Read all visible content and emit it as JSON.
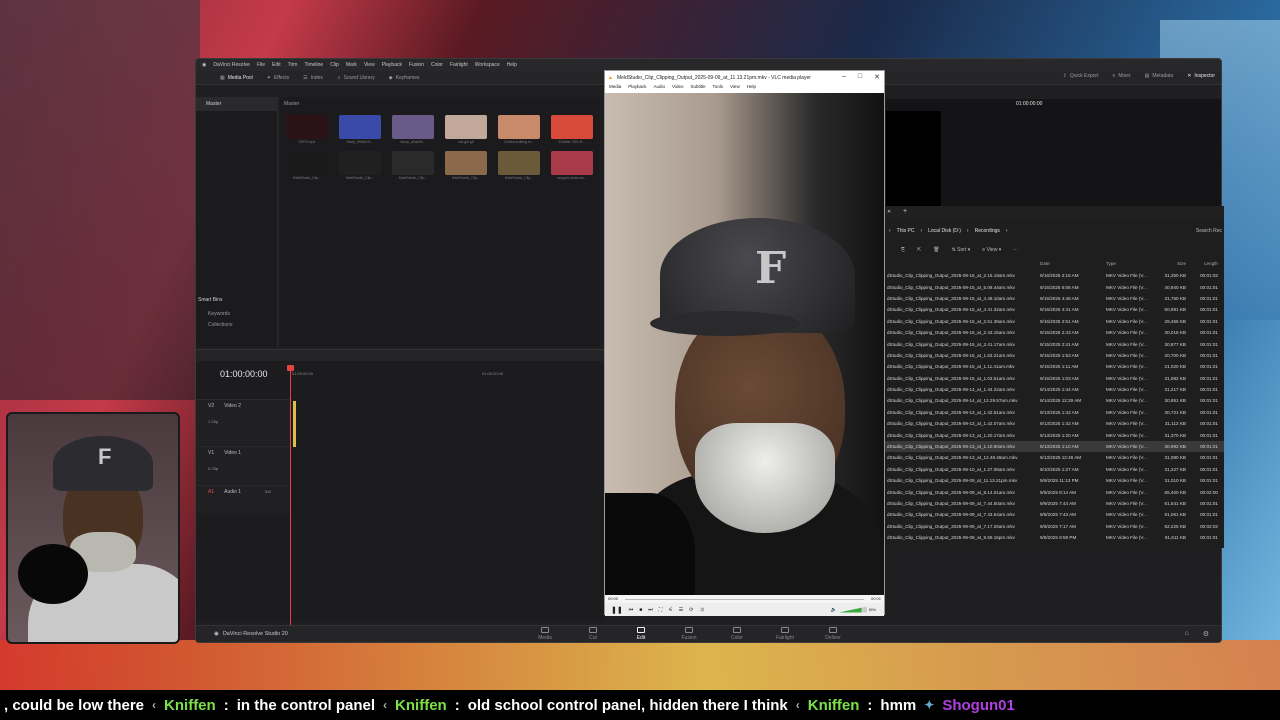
{
  "resolve": {
    "app_name": "DaVinci Resolve",
    "menu": [
      "File",
      "Edit",
      "Trim",
      "Timeline",
      "Clip",
      "Mark",
      "View",
      "Playback",
      "Fusion",
      "Color",
      "Fairlight",
      "Workspace",
      "Help"
    ],
    "toolbar": [
      "Media Pool",
      "Effects",
      "Index",
      "Sound Library",
      "Keyframes"
    ],
    "toolbar_right": [
      "Quick Export",
      "Mixer",
      "Metadata",
      "Inspector"
    ],
    "pool_label": "Master",
    "bin_label": "Master",
    "smart_bins": "Smart Bins",
    "smart_items": [
      "Keywords",
      "Collections"
    ],
    "thumbs": [
      {
        "caption": "00PO.mp4",
        "color": "#2a1216"
      },
      {
        "caption": "bluey_90b6c7b...",
        "color": "#3a4aa8"
      },
      {
        "caption": "bluey_a9da06...",
        "color": "#6a5a8a"
      },
      {
        "caption": "cat-gal.gif",
        "color": "#c2a898"
      },
      {
        "caption": "Godes-butking.m...",
        "color": "#c88a6a"
      },
      {
        "caption": "57ab6b-7f29-4f...",
        "color": "#d84a3a"
      },
      {
        "caption": "MeldStudio_Clip...",
        "color": "#1a1a1a"
      },
      {
        "caption": "MeldStudio_Clip...",
        "color": "#202020"
      },
      {
        "caption": "MeldStudio_Clip...",
        "color": "#2a2a2a"
      },
      {
        "caption": "MeldStudio_Clip...",
        "color": "#8a6a4a"
      },
      {
        "caption": "MeldStudio_Clip...",
        "color": "#6a5a3a"
      },
      {
        "caption": "muppet-show.mu...",
        "color": "#a83a4a"
      }
    ],
    "timecode": "01:00:00:00",
    "ruler": [
      "01:00:00:00",
      "01:00:20:00"
    ],
    "viewer_timecode": "01:00:00:00",
    "tracks": [
      {
        "id": "V2",
        "name": "Video 2",
        "clips": "1 Clip"
      },
      {
        "id": "V1",
        "name": "Video 1",
        "clips": "0 Clip"
      },
      {
        "id": "A1",
        "name": "Audio 1",
        "level": "2.0"
      }
    ],
    "footer_app": "DaVinci Resolve Studio 20",
    "pages": [
      "Media",
      "Cut",
      "Edit",
      "Fusion",
      "Color",
      "Fairlight",
      "Deliver"
    ],
    "active_page": "Edit"
  },
  "vlc": {
    "title": "MeldStudio_Clip_Clipping_Output_2025-09-09_at_11.13.21pm.mkv - VLC media player",
    "menu": [
      "Media",
      "Playback",
      "Audio",
      "Video",
      "Subtitle",
      "Tools",
      "View",
      "Help"
    ],
    "elapsed": "00:00",
    "remaining": "00:01",
    "volume": "80%"
  },
  "explorer": {
    "breadcrumb": [
      "This PC",
      "Local Disk (D:)",
      "Recordings"
    ],
    "search_placeholder": "Search Rec",
    "commands": [
      "Sort",
      "View"
    ],
    "columns": [
      "Name",
      "Date",
      "Type",
      "Size",
      "Length"
    ],
    "rows": [
      [
        "dStudio_Clip_Clipping_Output_2025-09-16_at_2.15.19am.mkv",
        "9/16/2025 2:15 AM",
        "MKV Video File (V...",
        "31,250 KB",
        "00:01:02"
      ],
      [
        "dStudio_Clip_Clipping_Output_2025-09-15_at_5.06.44am.mkv",
        "9/15/2025 5:06 AM",
        "MKV Video File (V...",
        "40,940 KB",
        "00:01:01"
      ],
      [
        "dStudio_Clip_Clipping_Output_2025-09-15_at_4.48.10am.mkv",
        "9/15/2025 4:48 AM",
        "MKV Video File (V...",
        "31,750 KB",
        "00:01:01"
      ],
      [
        "dStudio_Clip_Clipping_Output_2025-09-15_at_4.41.32am.mkv",
        "9/15/2025 4:41 AM",
        "MKV Video File (V...",
        "50,991 KB",
        "00:01:01"
      ],
      [
        "dStudio_Clip_Clipping_Output_2025-09-15_at_2.51.39am.mkv",
        "9/15/2025 2:51 AM",
        "MKV Video File (V...",
        "29,456 KB",
        "00:01:01"
      ],
      [
        "dStudio_Clip_Clipping_Output_2025-09-15_at_2.43.15am.mkv",
        "9/15/2025 2:43 AM",
        "MKV Video File (V...",
        "30,018 KB",
        "00:01:01"
      ],
      [
        "dStudio_Clip_Clipping_Output_2025-09-15_at_2.41.17am.mkv",
        "9/15/2025 2:41 AM",
        "MKV Video File (V...",
        "30,877 KB",
        "00:01:01"
      ],
      [
        "dStudio_Clip_Clipping_Output_2025-09-15_at_1.53.21am.mkv",
        "9/15/2025 1:53 AM",
        "MKV Video File (V...",
        "20,700 KB",
        "00:01:01"
      ],
      [
        "dStudio_Clip_Clipping_Output_2025-09-15_at_1.11.41am.mkv",
        "9/15/2025 1:11 AM",
        "MKV Video File (V...",
        "21,020 KB",
        "00:01:01"
      ],
      [
        "dStudio_Clip_Clipping_Output_2025-09-15_at_1.03.51am.mkv",
        "9/15/2025 1:03 AM",
        "MKV Video File (V...",
        "31,082 KB",
        "00:01:01"
      ],
      [
        "dStudio_Clip_Clipping_Output_2025-09-14_at_1.44.22am.mkv",
        "9/14/2025 1:44 AM",
        "MKV Video File (V...",
        "31,217 KB",
        "00:01:01"
      ],
      [
        "dStudio_Clip_Clipping_Output_2025-09-14_at_12.29.57am.mkv",
        "9/14/2025 12:29 AM",
        "MKV Video File (V...",
        "30,951 KB",
        "00:01:01"
      ],
      [
        "dStudio_Clip_Clipping_Output_2025-09-13_at_1.42.51am.mkv",
        "9/13/2025 1:42 AM",
        "MKV Video File (V...",
        "30,721 KB",
        "00:01:01"
      ],
      [
        "dStudio_Clip_Clipping_Output_2025-09-13_at_1.42.07am.mkv",
        "9/13/2025 1:42 AM",
        "MKV Video File (V...",
        "31,112 KB",
        "00:01:01"
      ],
      [
        "dStudio_Clip_Clipping_Output_2025-09-13_at_1.20.17am.mkv",
        "9/13/2025 1:20 AM",
        "MKV Video File (V...",
        "31,370 KB",
        "00:01:01"
      ],
      [
        "dStudio_Clip_Clipping_Output_2025-09-13_at_1.10.50am.mkv",
        "9/13/2025 1:10 AM",
        "MKV Video File (V...",
        "30,992 KB",
        "00:01:01"
      ],
      [
        "dStudio_Clip_Clipping_Output_2025-09-13_at_12.48.48am.mkv",
        "9/13/2025 12:48 AM",
        "MKV Video File (V...",
        "31,080 KB",
        "00:01:01"
      ],
      [
        "dStudio_Clip_Clipping_Output_2025-09-10_at_1.27.08am.mkv",
        "9/10/2025 1:27 AM",
        "MKV Video File (V...",
        "31,227 KB",
        "00:01:01"
      ],
      [
        "dStudio_Clip_Clipping_Output_2025-09-09_at_11.13.21pm.mkv",
        "9/9/2025 11:13 PM",
        "MKV Video File (V...",
        "31,010 KB",
        "00:01:01"
      ],
      [
        "dStudio_Clip_Clipping_Output_2025-09-09_at_8.14.01am.mkv",
        "9/9/2025 8:14 AM",
        "MKV Video File (V...",
        "65,400 KB",
        "00:02:00"
      ],
      [
        "dStudio_Clip_Clipping_Output_2025-09-09_at_7.44.50am.mkv",
        "9/9/2025 7:44 AM",
        "MKV Video File (V...",
        "61,541 KB",
        "00:01:01"
      ],
      [
        "dStudio_Clip_Clipping_Output_2025-09-09_at_7.43.54am.mkv",
        "9/9/2025 7:43 AM",
        "MKV Video File (V...",
        "61,061 KB",
        "00:01:01"
      ],
      [
        "dStudio_Clip_Clipping_Output_2025-09-09_at_7.17.29am.mkv",
        "9/9/2025 7:17 AM",
        "MKV Video File (V...",
        "62,225 KB",
        "00:02:02"
      ],
      [
        "dStudio_Clip_Clipping_Output_2025-09-08_at_9.59.16pm.mkv",
        "9/8/2025 9:59 PM",
        "MKV Video File (V...",
        "61,611 KB",
        "00:01:01"
      ]
    ],
    "selected_index": 15
  },
  "chat": [
    {
      "user": "",
      "text": ", could be low there"
    },
    {
      "user": "Kniffen",
      "text": "in the control panel"
    },
    {
      "user": "Kniffen",
      "text": "old school control panel, hidden there I think"
    },
    {
      "user": "Kniffen",
      "text": "hmm"
    }
  ],
  "chat_tail_user": "Shogun01",
  "colors": {
    "chat_user": "#7be04a",
    "playhead": "#e84040",
    "vlc_accent": "#ff8800"
  }
}
